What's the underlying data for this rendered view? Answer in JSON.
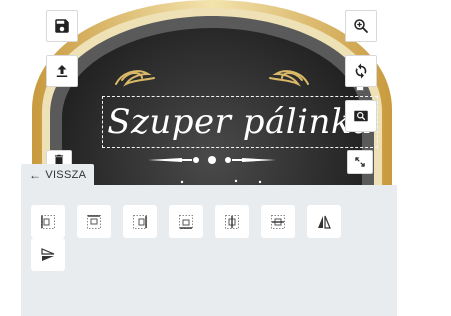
{
  "label_text": "Szuper pálinka",
  "back_label": "VISSZA",
  "colors": {
    "panel_bg": "#e8ecee",
    "label_dark": "#2b2b2b",
    "label_gold": "#d9b868",
    "label_gold_light": "#f0dfa8",
    "button_border": "#d8d8d8"
  },
  "toolbar_left": [
    {
      "name": "save-icon"
    },
    {
      "name": "upload-icon"
    },
    {
      "name": "delete-icon"
    }
  ],
  "toolbar_right": [
    {
      "name": "zoom-in-icon"
    },
    {
      "name": "rotate-icon"
    },
    {
      "name": "zoom-fit-icon"
    },
    {
      "name": "resize-icon"
    }
  ],
  "align_buttons": [
    {
      "name": "align-left-icon"
    },
    {
      "name": "align-center-horizontal-icon"
    },
    {
      "name": "align-right-icon"
    },
    {
      "name": "align-bottom-icon"
    },
    {
      "name": "align-center-vertical-icon"
    },
    {
      "name": "align-middle-icon"
    },
    {
      "name": "flip-horizontal-icon"
    },
    {
      "name": "flip-vertical-icon"
    }
  ]
}
